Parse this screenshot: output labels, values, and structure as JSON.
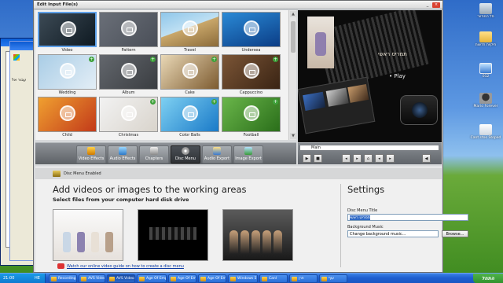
{
  "app": {
    "title": "Edit Input File(s)"
  },
  "templates": [
    {
      "label": "Video",
      "selected": true,
      "plus": false,
      "bg": "linear-gradient(135deg,#3c4a55,#0f1a22)"
    },
    {
      "label": "Pattern",
      "selected": false,
      "plus": false,
      "bg": "linear-gradient(135deg,#6a6f78,#4a4f58)"
    },
    {
      "label": "Travel",
      "selected": false,
      "plus": false,
      "bg": "linear-gradient(160deg,#8fc6ea 0%,#bfe0f3 45%,#c9a76a 46%,#8b6b3a 100%)"
    },
    {
      "label": "Undersea",
      "selected": false,
      "plus": false,
      "bg": "linear-gradient(160deg,#2a8ad6,#0b3d86)"
    },
    {
      "label": "Wedding",
      "selected": false,
      "plus": true,
      "bg": "linear-gradient(135deg,#a9cde6,#e3eef6)"
    },
    {
      "label": "Album",
      "selected": false,
      "plus": true,
      "bg": "linear-gradient(135deg,#63676d,#3a3d41)"
    },
    {
      "label": "Cake",
      "selected": false,
      "plus": true,
      "bg": "linear-gradient(135deg,#e9d8b6,#7d5b30)"
    },
    {
      "label": "Cappuccino",
      "selected": false,
      "plus": true,
      "bg": "linear-gradient(135deg,#7b5536,#3a2414)"
    },
    {
      "label": "Child",
      "selected": false,
      "plus": false,
      "bg": "linear-gradient(135deg,#f0a030,#c23a1a)"
    },
    {
      "label": "Christmas",
      "selected": false,
      "plus": true,
      "bg": "linear-gradient(135deg,#f2f2f2,#d9d4cc)"
    },
    {
      "label": "Color Balls",
      "selected": false,
      "plus": true,
      "bg": "linear-gradient(135deg,#7ed0f2,#1a7ac8)"
    },
    {
      "label": "Football",
      "selected": false,
      "plus": true,
      "bg": "linear-gradient(135deg,#6ab64a,#2a6e1a)"
    }
  ],
  "preview": {
    "menu_title": "תמריס ראשי",
    "play_label": "• Play"
  },
  "toolbar": {
    "video_effects": "Video Effects",
    "audio_effects": "Audio Effects",
    "chapters": "Chapters",
    "disc_menu": "Disc Menu",
    "audio_export": "Audio Export",
    "image_export": "Image Export"
  },
  "player": {
    "menu_value": "Main"
  },
  "disc": {
    "enabled_label": "Disc Menu Enabled"
  },
  "work": {
    "heading": "Add videos or images to the working areas",
    "subheading": "Select files from your computer hard disk drive",
    "guide_link": "Watch our online video guide on how to create a disc menu"
  },
  "settings": {
    "title": "Settings",
    "menu_title_label": "Disc Menu Title",
    "menu_title_value": "תפריט ראשי",
    "bg_music_label": "Background Music",
    "bg_music_value": "Change background music...",
    "browse": "Browse..."
  },
  "desktop": {
    "icons": [
      "סל המחזור",
      "תיקיות חדשות",
      "012",
      "Mario Forever",
      "Cant stoo Stoped"
    ]
  },
  "background_window": {
    "text": "עבור אל"
  },
  "taskbar": {
    "clock": "21:00",
    "lang": "HE",
    "items": [
      "Recording",
      "AVS Video Co",
      "AVS Video Co",
      "Age Of Empi",
      "Age Of Empi",
      "Age Of Empi",
      "Windows 5",
      "Canl",
      "פרן",
      "עוף"
    ],
    "start": "התחל"
  }
}
